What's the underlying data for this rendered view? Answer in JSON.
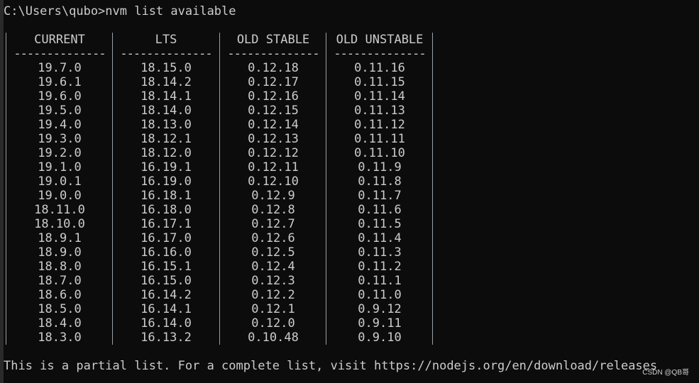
{
  "terminal": {
    "prompt_line": "C:\\Users\\qubo>nvm list available",
    "footer_line": "This is a partial list. For a complete list, visit https://nodejs.org/en/download/releases",
    "watermark": "CSDN @QB哥"
  },
  "table": {
    "dashes": "--------------",
    "columns": [
      {
        "header": "CURRENT",
        "values": [
          "19.7.0",
          "19.6.1",
          "19.6.0",
          "19.5.0",
          "19.4.0",
          "19.3.0",
          "19.2.0",
          "19.1.0",
          "19.0.1",
          "19.0.0",
          "18.11.0",
          "18.10.0",
          "18.9.1",
          "18.9.0",
          "18.8.0",
          "18.7.0",
          "18.6.0",
          "18.5.0",
          "18.4.0",
          "18.3.0"
        ]
      },
      {
        "header": "LTS",
        "values": [
          "18.15.0",
          "18.14.2",
          "18.14.1",
          "18.14.0",
          "18.13.0",
          "18.12.1",
          "18.12.0",
          "16.19.1",
          "16.19.0",
          "16.18.1",
          "16.18.0",
          "16.17.1",
          "16.17.0",
          "16.16.0",
          "16.15.1",
          "16.15.0",
          "16.14.2",
          "16.14.1",
          "16.14.0",
          "16.13.2"
        ]
      },
      {
        "header": "OLD STABLE",
        "values": [
          "0.12.18",
          "0.12.17",
          "0.12.16",
          "0.12.15",
          "0.12.14",
          "0.12.13",
          "0.12.12",
          "0.12.11",
          "0.12.10",
          "0.12.9",
          "0.12.8",
          "0.12.7",
          "0.12.6",
          "0.12.5",
          "0.12.4",
          "0.12.3",
          "0.12.2",
          "0.12.1",
          "0.12.0",
          "0.10.48"
        ]
      },
      {
        "header": "OLD UNSTABLE",
        "values": [
          "0.11.16",
          "0.11.15",
          "0.11.14",
          "0.11.13",
          "0.11.12",
          "0.11.11",
          "0.11.10",
          "0.11.9",
          "0.11.8",
          "0.11.7",
          "0.11.6",
          "0.11.5",
          "0.11.4",
          "0.11.3",
          "0.11.2",
          "0.11.1",
          "0.11.0",
          "0.9.12",
          "0.9.11",
          "0.9.10"
        ]
      }
    ]
  }
}
